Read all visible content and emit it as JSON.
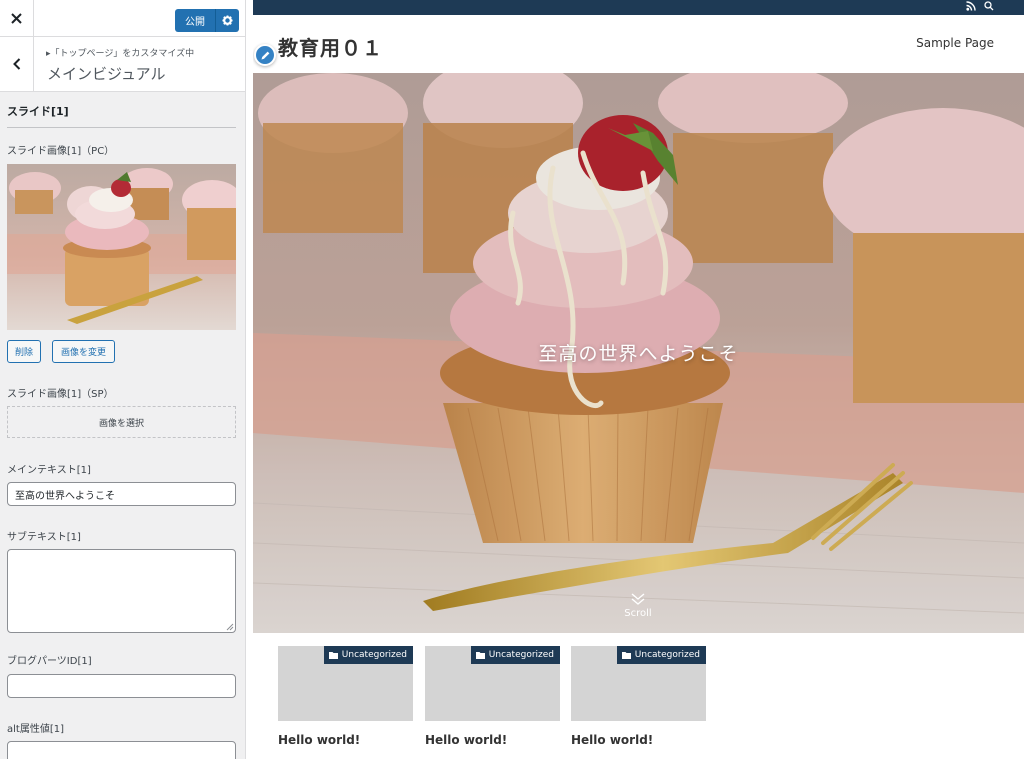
{
  "customizer": {
    "publish_label": "公開",
    "breadcrumb": "▸「トップページ」をカスタマイズ中",
    "section_title": "メインビジュアル",
    "slide_heading": "スライド[1]",
    "slide_image_pc_label": "スライド画像[1]（PC）",
    "remove_label": "削除",
    "change_image_label": "画像を変更",
    "slide_image_sp_label": "スライド画像[1]（SP）",
    "select_image_label": "画像を選択",
    "main_text_label": "メインテキスト[1]",
    "main_text_value": "至高の世界へようこそ",
    "sub_text_label": "サブテキスト[1]",
    "sub_text_value": "",
    "blog_parts_label": "ブログパーツID[1]",
    "blog_parts_value": "",
    "alt_label": "alt属性値[1]",
    "alt_value": ""
  },
  "site": {
    "title": "教育用０１",
    "nav": [
      "Sample Page"
    ],
    "hero_text": "至高の世界へようこそ",
    "scroll_label": "Scroll",
    "posts": [
      {
        "category": "Uncategorized",
        "title": "Hello world!"
      },
      {
        "category": "Uncategorized",
        "title": "Hello world!"
      },
      {
        "category": "Uncategorized",
        "title": "Hello world!"
      }
    ]
  },
  "colors": {
    "accent": "#2271b1",
    "topbar": "#1e3a55"
  },
  "icons": [
    "close-icon",
    "gear-icon",
    "chevron-left-icon",
    "rss-icon",
    "search-icon",
    "pencil-icon",
    "folder-icon",
    "double-chevron-down-icon"
  ]
}
